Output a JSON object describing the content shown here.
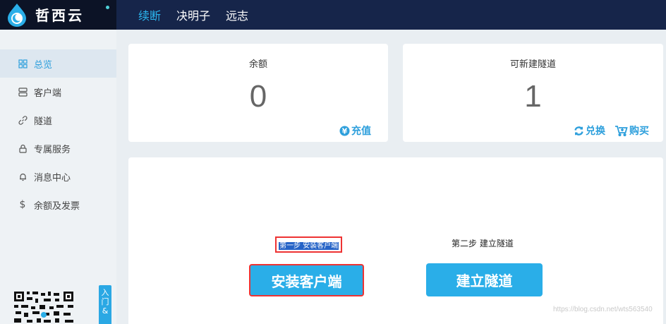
{
  "header": {
    "brand": "哲西云",
    "nav": [
      "续断",
      "决明子",
      "远志"
    ],
    "active_nav": 0
  },
  "sidebar": {
    "items": [
      {
        "label": "总览",
        "icon": "grid-icon"
      },
      {
        "label": "客户端",
        "icon": "server-icon"
      },
      {
        "label": "隧道",
        "icon": "link-icon"
      },
      {
        "label": "专属服务",
        "icon": "lock-icon"
      },
      {
        "label": "消息中心",
        "icon": "bell-icon"
      },
      {
        "label": "余额及发票",
        "icon": "dollar-icon"
      }
    ],
    "guide_tab": "入门&"
  },
  "balance_card": {
    "title": "余额",
    "value": "0",
    "recharge_label": "充值"
  },
  "tunnel_card": {
    "title": "可新建隧道",
    "value": "1",
    "exchange_label": "兑换",
    "buy_label": "购买"
  },
  "steps": {
    "step1_label": "第一步 安装客户端",
    "step1_button": "安装客户端",
    "step2_label": "第二步 建立隧道",
    "step2_button": "建立隧道"
  },
  "watermark": "https://blog.csdn.net/wts563540",
  "colors": {
    "accent": "#2aaee8",
    "header": "#16254a",
    "highlight_border": "#e33333"
  }
}
